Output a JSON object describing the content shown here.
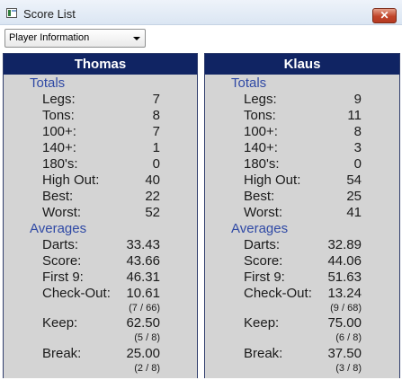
{
  "window": {
    "title": "Score List",
    "close_label": "✕"
  },
  "view_select": {
    "value": "Player Information"
  },
  "headings": {
    "totals": "Totals",
    "averages": "Averages"
  },
  "labels": {
    "legs": "Legs:",
    "tons": "Tons:",
    "p100": "100+:",
    "p140": "140+:",
    "p180": "180's:",
    "high_out": "High Out:",
    "best": "Best:",
    "worst": "Worst:",
    "darts": "Darts:",
    "score": "Score:",
    "first9": "First 9:",
    "checkout": "Check-Out:",
    "keep": "Keep:",
    "break": "Break:"
  },
  "players": [
    {
      "name": "Thomas",
      "totals": {
        "legs": "7",
        "tons": "8",
        "p100": "7",
        "p140": "1",
        "p180": "0",
        "high_out": "40",
        "best": "22",
        "worst": "52"
      },
      "averages": {
        "darts": "33.43",
        "score": "43.66",
        "first9": "46.31",
        "checkout": "10.61",
        "checkout_detail": "(7 / 66)",
        "keep": "62.50",
        "keep_detail": "(5 / 8)",
        "break": "25.00",
        "break_detail": "(2 / 8)"
      }
    },
    {
      "name": "Klaus",
      "totals": {
        "legs": "9",
        "tons": "11",
        "p100": "8",
        "p140": "3",
        "p180": "0",
        "high_out": "54",
        "best": "25",
        "worst": "41"
      },
      "averages": {
        "darts": "32.89",
        "score": "44.06",
        "first9": "51.63",
        "checkout": "13.24",
        "checkout_detail": "(9 / 68)",
        "keep": "75.00",
        "keep_detail": "(6 / 8)",
        "break": "37.50",
        "break_detail": "(3 / 8)"
      }
    }
  ]
}
